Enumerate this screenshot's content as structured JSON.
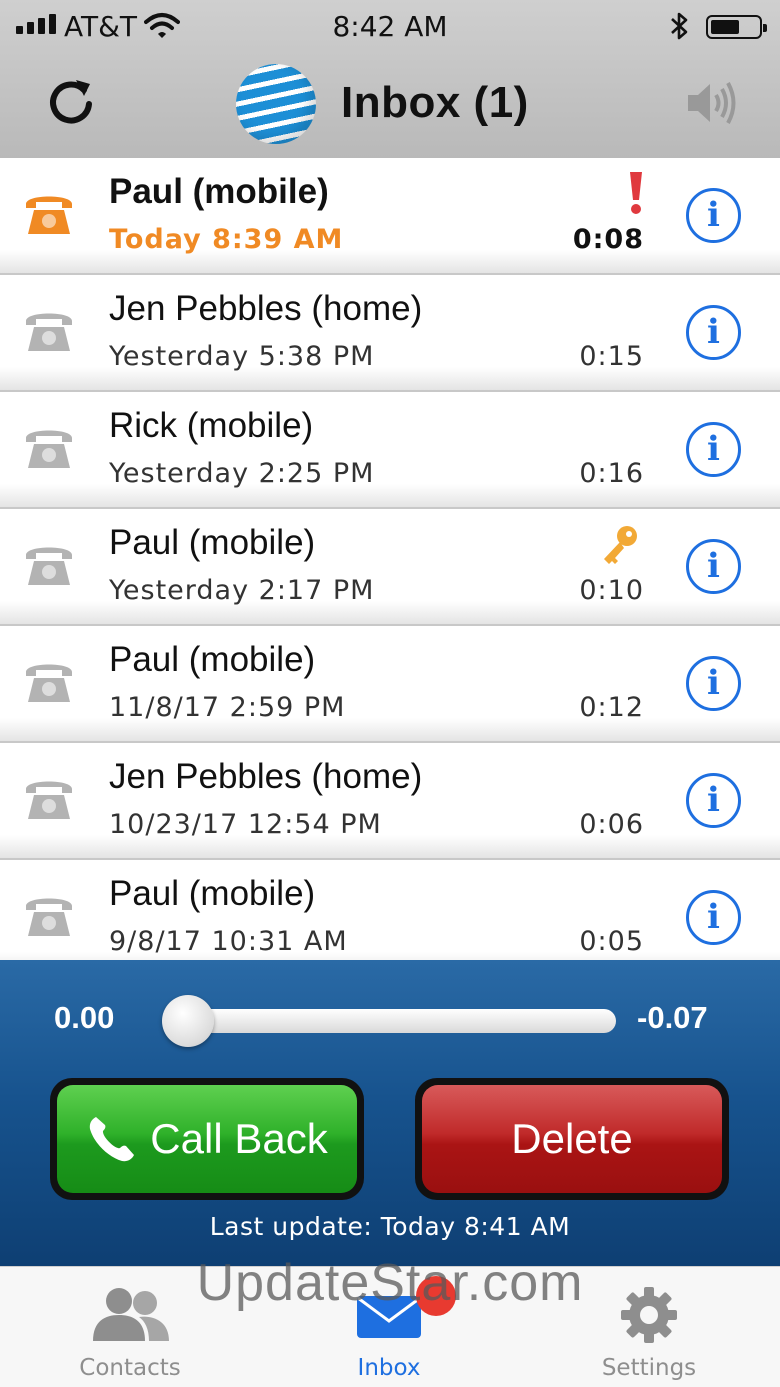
{
  "status_bar": {
    "carrier": "AT&T",
    "time": "8:42 AM",
    "battery_level": 0.6
  },
  "header": {
    "title": "Inbox (1)",
    "refresh_icon": "refresh-icon",
    "logo": "att-logo",
    "speaker_icon": "speaker-icon"
  },
  "messages": [
    {
      "name": "Paul (mobile)",
      "when": "Today 8:39 AM",
      "duration": "0:08",
      "unread": true,
      "flag": "urgent"
    },
    {
      "name": "Jen Pebbles (home)",
      "when": "Yesterday 5:38 PM",
      "duration": "0:15",
      "unread": false,
      "flag": ""
    },
    {
      "name": "Rick (mobile)",
      "when": "Yesterday 2:25 PM",
      "duration": "0:16",
      "unread": false,
      "flag": ""
    },
    {
      "name": "Paul (mobile)",
      "when": "Yesterday 2:17 PM",
      "duration": "0:10",
      "unread": false,
      "flag": "key"
    },
    {
      "name": "Paul (mobile)",
      "when": "11/8/17 2:59 PM",
      "duration": "0:12",
      "unread": false,
      "flag": ""
    },
    {
      "name": "Jen Pebbles (home)",
      "when": "10/23/17 12:54 PM",
      "duration": "0:06",
      "unread": false,
      "flag": ""
    },
    {
      "name": "Paul (mobile)",
      "when": "9/8/17 10:31 AM",
      "duration": "0:05",
      "unread": false,
      "flag": ""
    }
  ],
  "info_label": "i",
  "player": {
    "elapsed": "0.00",
    "remaining": "-0.07",
    "progress": 0.0,
    "call_back_label": "Call Back",
    "delete_label": "Delete",
    "last_update": "Last update: Today 8:41 AM"
  },
  "tabs": [
    {
      "label": "Contacts",
      "icon": "contacts-icon",
      "active": false
    },
    {
      "label": "Inbox",
      "icon": "mail-icon",
      "active": true
    },
    {
      "label": "Settings",
      "icon": "gear-icon",
      "active": false
    }
  ],
  "watermark": "UpdateStar.com",
  "colors": {
    "unread_accent": "#f08a24",
    "link_blue": "#1e6fe0",
    "call_back_green": "#2fb12a",
    "delete_red": "#aa1414",
    "player_blue": "#17538e"
  }
}
